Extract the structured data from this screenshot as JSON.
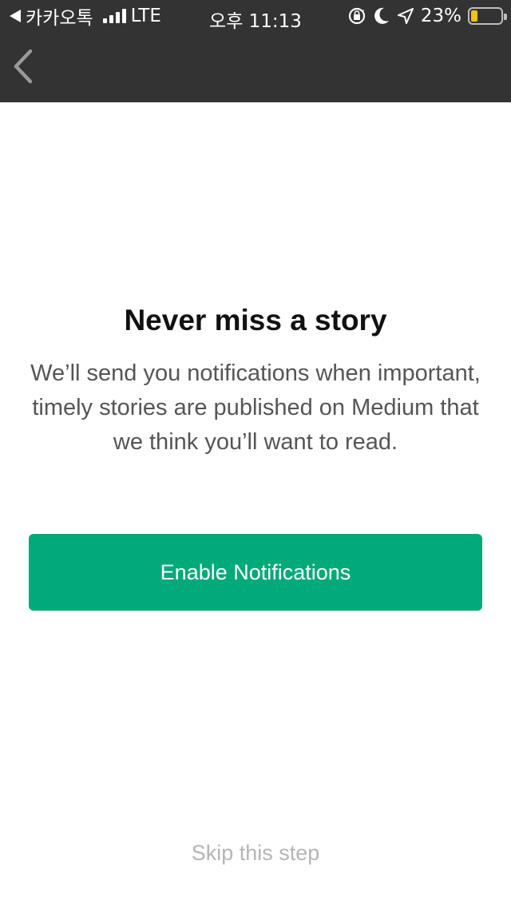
{
  "status_bar": {
    "carrier": "카카오톡",
    "network": "LTE",
    "time": "오후 11:13",
    "battery_percent": "23%",
    "battery_level": 0.23,
    "icons": [
      "back-to-app-icon",
      "signal-icon",
      "rotation-lock-icon",
      "moon-icon",
      "location-icon",
      "battery-icon"
    ]
  },
  "nav": {
    "back_icon": "chevron-left-icon"
  },
  "main": {
    "title": "Never miss a story",
    "body": "We’ll send you notifications when important, timely stories are published on Medium that we think you’ll want to read.",
    "enable_button": "Enable Notifications",
    "skip_link": "Skip this step"
  },
  "colors": {
    "header_bg": "#333333",
    "accent": "#02a979",
    "title": "#111111",
    "body_text": "#555555",
    "skip_text": "#b5b5b5"
  }
}
